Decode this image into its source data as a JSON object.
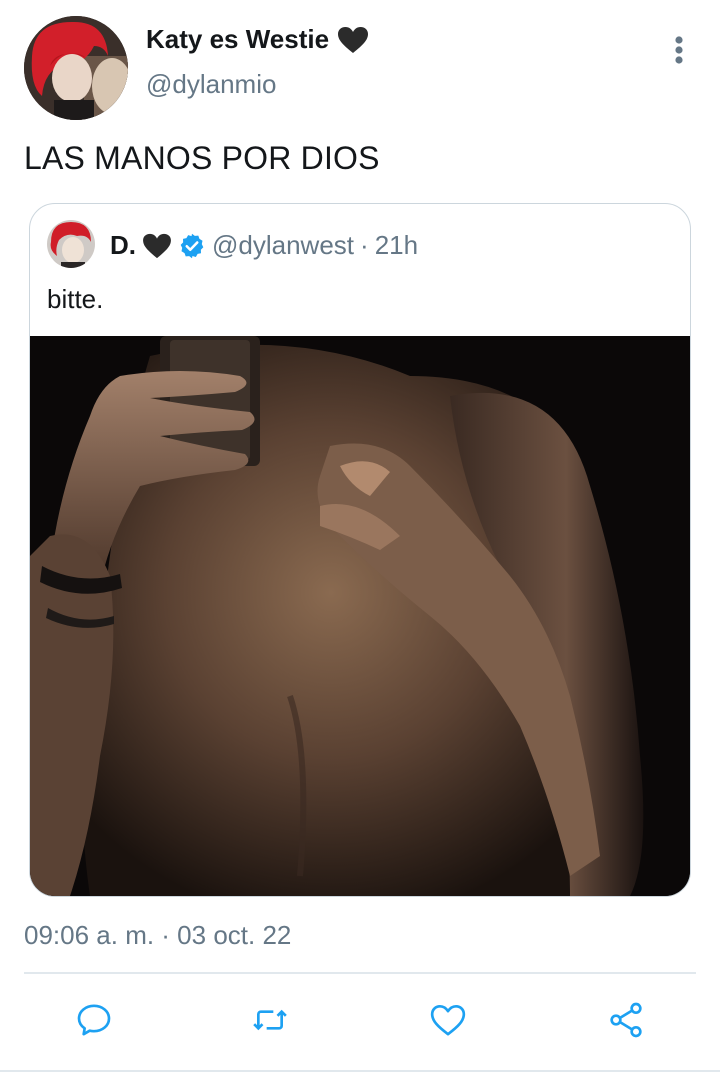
{
  "tweet": {
    "author": {
      "display_name": "Katy es Westie",
      "name_emoji": "black-heart",
      "username": "@dylanmio"
    },
    "more_icon": "more-vertical-icon",
    "text": "LAS MANOS POR DIOS",
    "timestamp": "09:06 a. m. · 03 oct. 22"
  },
  "quoted_tweet": {
    "display_name": "D.",
    "name_emoji": "black-heart",
    "verified": true,
    "username": "@dylanwest",
    "separator": "·",
    "time_ago": "21h",
    "text": "bitte."
  },
  "actions": [
    {
      "name": "reply",
      "icon": "speech-bubble-icon"
    },
    {
      "name": "retweet",
      "icon": "retweet-icon"
    },
    {
      "name": "like",
      "icon": "heart-outline-icon"
    },
    {
      "name": "share",
      "icon": "share-icon"
    }
  ],
  "colors": {
    "text_primary": "#14171a",
    "text_secondary": "#657786",
    "verified_blue": "#1da1f2",
    "border": "#ccd6dd",
    "icon_gray": "#1da1f2"
  }
}
